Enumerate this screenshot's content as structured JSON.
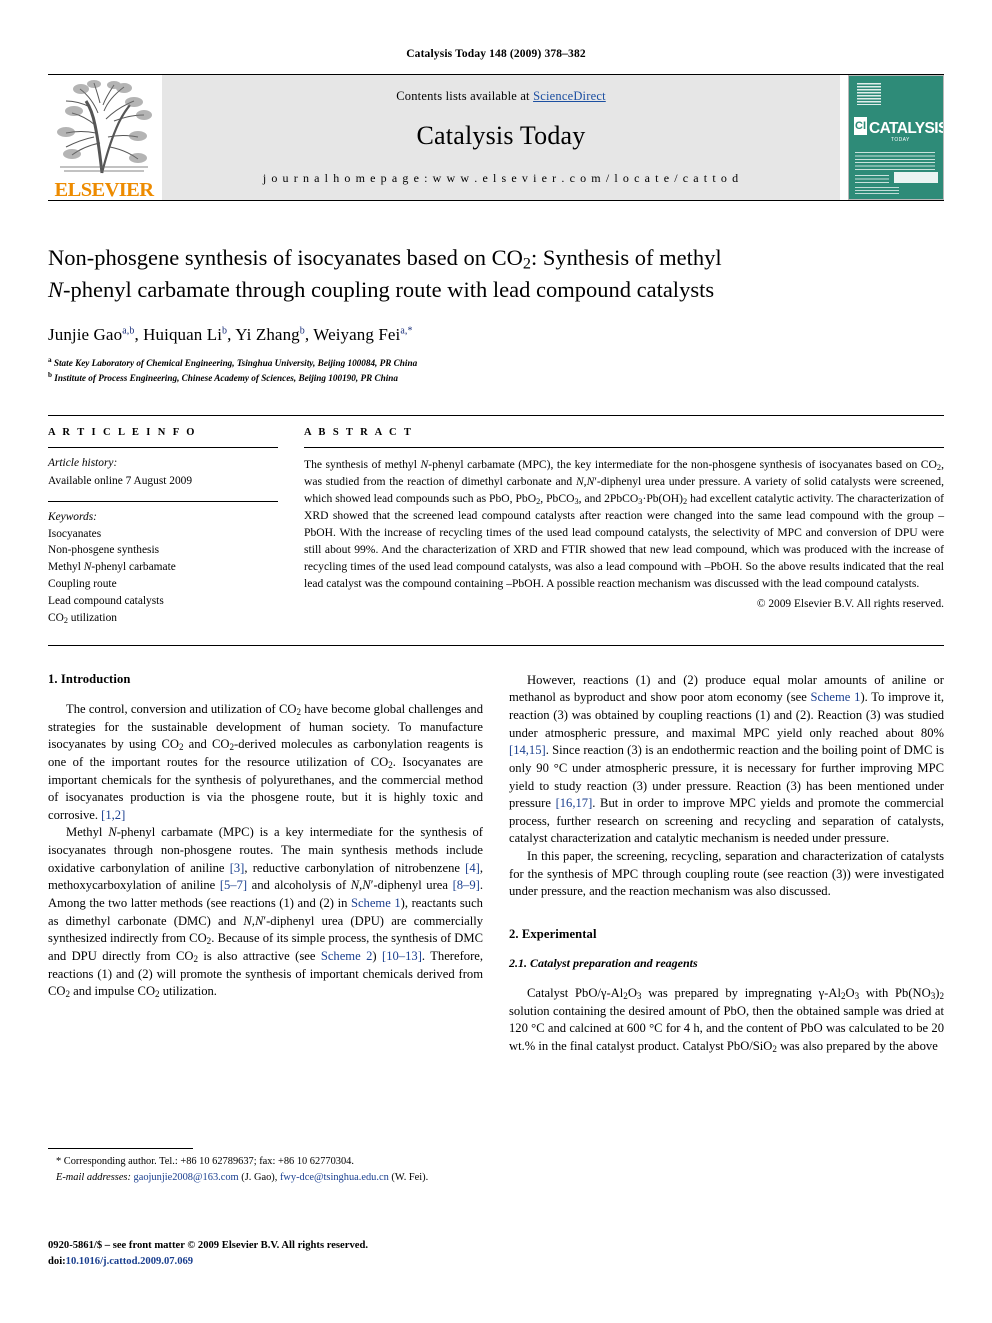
{
  "running_head": "Catalysis Today 148 (2009) 378–382",
  "masthead": {
    "contents_prefix": "Contents lists available at ",
    "sciencedirect": "ScienceDirect",
    "journal_name": "Catalysis Today",
    "homepage": "j o u r n a l   h o m e p a g e :   w w w . e l s e v i e r . c o m / l o c a t e / c a t t o d",
    "publisher_logo_text": "ELSEVIER",
    "cover_title": "CATALYSIS",
    "cover_subtitle": "TODAY",
    "cover_ci": "CI"
  },
  "article": {
    "title_line1": "Non-phosgene synthesis of isocyanates based on CO2: Synthesis of methyl",
    "title_line2": "N-phenyl carbamate through coupling route with lead compound catalysts",
    "authors_plain": "Junjie Gao a,b, Huiquan Li b, Yi Zhang b, Weiyang Fei a,*",
    "affiliation_a": "State Key Laboratory of Chemical Engineering, Tsinghua University, Beijing 100084, PR China",
    "affiliation_b": "Institute of Process Engineering, Chinese Academy of Sciences, Beijing 100190, PR China"
  },
  "article_info": {
    "heading": "A R T I C L E   I N F O",
    "history_label": "Article history:",
    "history_value": "Available online 7 August 2009",
    "keywords_label": "Keywords:",
    "keywords": [
      "Isocyanates",
      "Non-phosgene synthesis",
      "Methyl N-phenyl carbamate",
      "Coupling route",
      "Lead compound catalysts",
      "CO2 utilization"
    ]
  },
  "abstract": {
    "heading": "A B S T R A C T",
    "text": "The synthesis of methyl N-phenyl carbamate (MPC), the key intermediate for the non-phosgene synthesis of isocyanates based on CO2, was studied from the reaction of dimethyl carbonate and N,N′-diphenyl urea under pressure. A variety of solid catalysts were screened, which showed lead compounds such as PbO, PbO2, PbCO3, and 2PbCO3·Pb(OH)2 had excellent catalytic activity. The characterization of XRD showed that the screened lead compound catalysts after reaction were changed into the same lead compound with the group –PbOH. With the increase of recycling times of the used lead compound catalysts, the selectivity of MPC and conversion of DPU were still about 99%. And the characterization of XRD and FTIR showed that new lead compound, which was produced with the increase of recycling times of the used lead compound catalysts, was also a lead compound with –PbOH. So the above results indicated that the real lead catalyst was the compound containing –PbOH. A possible reaction mechanism was discussed with the lead compound catalysts.",
    "copyright": "© 2009 Elsevier B.V. All rights reserved."
  },
  "sections": {
    "introduction_heading": "1. Introduction",
    "intro_p1": "The control, conversion and utilization of CO2 have become global challenges and strategies for the sustainable development of human society. To manufacture isocyanates by using CO2 and CO2-derived molecules as carbonylation reagents is one of the important routes for the resource utilization of CO2. Isocyanates are important chemicals for the synthesis of polyurethanes, and the commercial method of isocyanates production is via the phosgene route, but it is highly toxic and corrosive. [1,2]",
    "intro_p2": "Methyl N-phenyl carbamate (MPC) is a key intermediate for the synthesis of isocyanates through non-phosgene routes. The main synthesis methods include oxidative carbonylation of aniline [3], reductive carbonylation of nitrobenzene [4], methoxycarboxylation of aniline [5–7] and alcoholysis of N,N′-diphenyl urea [8–9]. Among the two latter methods (see reactions (1) and (2) in Scheme 1), reactants such as dimethyl carbonate (DMC) and N,N′-diphenyl urea (DPU) are commercially synthesized indirectly from CO2. Because of its simple process, the synthesis of DMC and DPU directly from CO2 is also attractive (see Scheme 2) [10–13]. Therefore, reactions (1) and (2) will promote the synthesis of important chemicals derived from CO2 and impulse CO2 utilization.",
    "intro_p3": "However, reactions (1) and (2) produce equal molar amounts of aniline or methanol as byproduct and show poor atom economy (see Scheme 1). To improve it, reaction (3) was obtained by coupling reactions (1) and (2). Reaction (3) was studied under atmospheric pressure, and maximal MPC yield only reached about 80% [14,15]. Since reaction (3) is an endothermic reaction and the boiling point of DMC is only 90 °C under atmospheric pressure, it is necessary for further improving MPC yield to study reaction (3) under pressure. Reaction (3) has been mentioned under pressure [16,17]. But in order to improve MPC yields and promote the commercial process, further research on screening and recycling and separation of catalysts, catalyst characterization and catalytic mechanism is needed under pressure.",
    "intro_p4": "In this paper, the screening, recycling, separation and characterization of catalysts for the synthesis of MPC through coupling route (see reaction (3)) were investigated under pressure, and the reaction mechanism was also discussed.",
    "experimental_heading": "2. Experimental",
    "experimental_sub": "2.1. Catalyst preparation and reagents",
    "exp_p1": "Catalyst PbO/γ-Al2O3 was prepared by impregnating γ-Al2O3 with Pb(NO3)2 solution containing the desired amount of PbO, then the obtained sample was dried at 120 °C and calcined at 600 °C for 4 h, and the content of PbO was calculated to be 20 wt.% in the final catalyst product. Catalyst PbO/SiO2 was also prepared by the above"
  },
  "footnote": {
    "corresponding": "* Corresponding author. Tel.: +86 10 62789637; fax: +86 10 62770304.",
    "email_label": "E-mail addresses:",
    "email1": "gaojunjie2008@163.com",
    "email1_name": "(J. Gao),",
    "email2": "fwy-dce@tsinghua.edu.cn",
    "email2_name": "(W. Fei)."
  },
  "issn": {
    "line1": "0920-5861/$ – see front matter © 2009 Elsevier B.V. All rights reserved.",
    "doi_label": "doi:",
    "doi_value": "10.1016/j.cattod.2009.07.069"
  },
  "colors": {
    "link": "#1a3f8f",
    "elsevier_orange": "#ED8B00",
    "cover_green": "#2e8b78",
    "banner_gray": "#e6e6e6"
  }
}
